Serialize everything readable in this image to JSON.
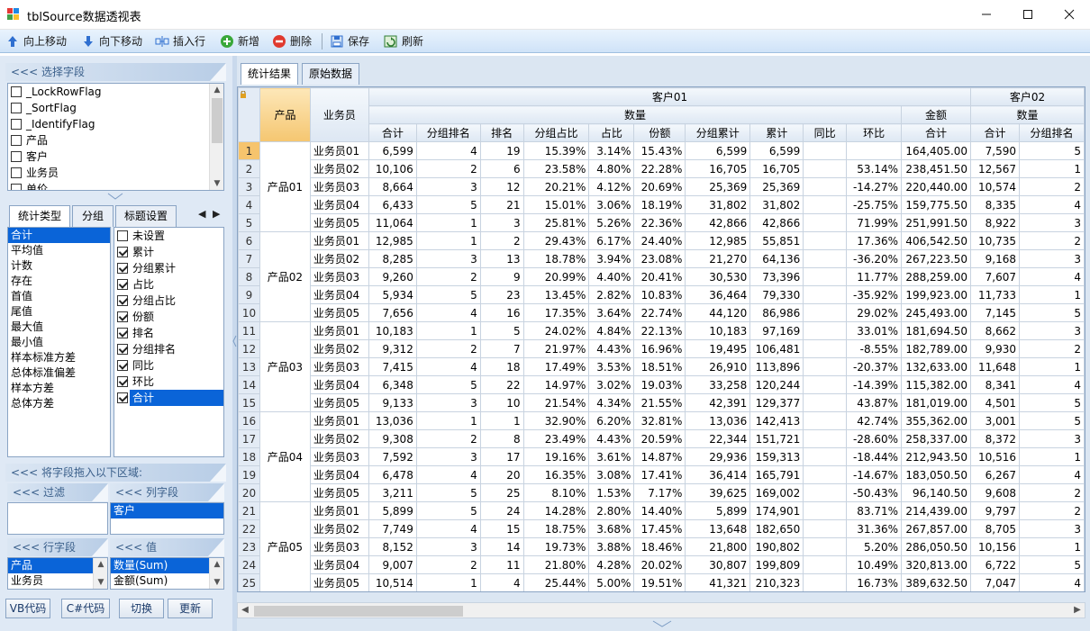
{
  "window": {
    "title": "tblSource数据透视表"
  },
  "toolbar": {
    "move_up": "向上移动",
    "move_down": "向下移动",
    "insert_row": "插入行",
    "add": "新增",
    "delete": "删除",
    "save": "保存",
    "refresh": "刷新"
  },
  "field_panel": {
    "header": "<<< 选择字段",
    "fields": [
      {
        "label": "_LockRowFlag",
        "checked": false
      },
      {
        "label": "_SortFlag",
        "checked": false
      },
      {
        "label": "_IdentifyFlag",
        "checked": false
      },
      {
        "label": "产品",
        "checked": false
      },
      {
        "label": "客户",
        "checked": false
      },
      {
        "label": "业务员",
        "checked": false
      },
      {
        "label": "单价",
        "checked": false
      }
    ]
  },
  "stat_tabs": [
    "统计类型",
    "分组",
    "标题设置"
  ],
  "stat_types": [
    "合计",
    "平均值",
    "计数",
    "存在",
    "首值",
    "尾值",
    "最大值",
    "最小值",
    "样本标准方差",
    "总体标准偏差",
    "样本方差",
    "总体方差"
  ],
  "stat_options": [
    {
      "label": "未设置",
      "checked": false
    },
    {
      "label": "累计",
      "checked": true
    },
    {
      "label": "分组累计",
      "checked": true
    },
    {
      "label": "占比",
      "checked": true
    },
    {
      "label": "分组占比",
      "checked": true
    },
    {
      "label": "份额",
      "checked": true
    },
    {
      "label": "排名",
      "checked": true
    },
    {
      "label": "分组排名",
      "checked": true
    },
    {
      "label": "同比",
      "checked": true
    },
    {
      "label": "环比",
      "checked": true
    },
    {
      "label": "合计",
      "checked": true
    }
  ],
  "drag_area": {
    "header": "<<< 将字段拖入以下区域:",
    "filter_header": "<<< 过滤",
    "column_header": "<<< 列字段",
    "column_fields": [
      "客户"
    ],
    "row_header": "<<< 行字段",
    "row_fields": [
      "产品",
      "业务员"
    ],
    "value_header": "<<< 值",
    "value_fields": [
      "数量(Sum)",
      "金额(Sum)"
    ]
  },
  "buttons": {
    "vb": "VB代码",
    "cs": "C#代码",
    "switch": "切换",
    "update": "更新"
  },
  "result_tabs": [
    "统计结果",
    "原始数据"
  ],
  "grid": {
    "row_field_product": "产品",
    "row_field_rep": "业务员",
    "customer1": "客户01",
    "customer2": "客户02",
    "qty_label": "数量",
    "amount_label": "金额",
    "qty_cols": [
      "合计",
      "分组排名",
      "排名",
      "分组占比",
      "占比",
      "份额",
      "分组累计",
      "累计",
      "同比",
      "环比"
    ],
    "amount_cols": [
      "合计"
    ],
    "c2_cols": [
      "合计",
      "分组排名"
    ],
    "products": [
      "产品01",
      "产品02",
      "产品03",
      "产品04",
      "产品05"
    ],
    "rows": [
      {
        "n": "1",
        "rep": "业务员01",
        "v": [
          "6,599",
          "4",
          "19",
          "15.39%",
          "3.14%",
          "15.43%",
          "6,599",
          "6,599",
          "",
          ""
        ],
        "amt": "164,405.00",
        "c2": [
          "7,590",
          "5"
        ]
      },
      {
        "n": "2",
        "rep": "业务员02",
        "v": [
          "10,106",
          "2",
          "6",
          "23.58%",
          "4.80%",
          "22.28%",
          "16,705",
          "16,705",
          "",
          "53.14%"
        ],
        "amt": "238,451.50",
        "c2": [
          "12,567",
          "1"
        ]
      },
      {
        "n": "3",
        "rep": "业务员03",
        "v": [
          "8,664",
          "3",
          "12",
          "20.21%",
          "4.12%",
          "20.69%",
          "25,369",
          "25,369",
          "",
          "-14.27%"
        ],
        "amt": "220,440.00",
        "c2": [
          "10,574",
          "2"
        ]
      },
      {
        "n": "4",
        "rep": "业务员04",
        "v": [
          "6,433",
          "5",
          "21",
          "15.01%",
          "3.06%",
          "18.19%",
          "31,802",
          "31,802",
          "",
          "-25.75%"
        ],
        "amt": "159,775.50",
        "c2": [
          "8,335",
          "4"
        ]
      },
      {
        "n": "5",
        "rep": "业务员05",
        "v": [
          "11,064",
          "1",
          "3",
          "25.81%",
          "5.26%",
          "22.36%",
          "42,866",
          "42,866",
          "",
          "71.99%"
        ],
        "amt": "251,991.50",
        "c2": [
          "8,922",
          "3"
        ]
      },
      {
        "n": "6",
        "rep": "业务员01",
        "v": [
          "12,985",
          "1",
          "2",
          "29.43%",
          "6.17%",
          "24.40%",
          "12,985",
          "55,851",
          "",
          "17.36%"
        ],
        "amt": "406,542.50",
        "c2": [
          "10,735",
          "2"
        ]
      },
      {
        "n": "7",
        "rep": "业务员02",
        "v": [
          "8,285",
          "3",
          "13",
          "18.78%",
          "3.94%",
          "23.08%",
          "21,270",
          "64,136",
          "",
          "-36.20%"
        ],
        "amt": "267,223.50",
        "c2": [
          "9,168",
          "3"
        ]
      },
      {
        "n": "8",
        "rep": "业务员03",
        "v": [
          "9,260",
          "2",
          "9",
          "20.99%",
          "4.40%",
          "20.41%",
          "30,530",
          "73,396",
          "",
          "11.77%"
        ],
        "amt": "288,259.00",
        "c2": [
          "7,607",
          "4"
        ]
      },
      {
        "n": "9",
        "rep": "业务员04",
        "v": [
          "5,934",
          "5",
          "23",
          "13.45%",
          "2.82%",
          "10.83%",
          "36,464",
          "79,330",
          "",
          "-35.92%"
        ],
        "amt": "199,923.00",
        "c2": [
          "11,733",
          "1"
        ]
      },
      {
        "n": "10",
        "rep": "业务员05",
        "v": [
          "7,656",
          "4",
          "16",
          "17.35%",
          "3.64%",
          "22.74%",
          "44,120",
          "86,986",
          "",
          "29.02%"
        ],
        "amt": "245,493.00",
        "c2": [
          "7,145",
          "5"
        ]
      },
      {
        "n": "11",
        "rep": "业务员01",
        "v": [
          "10,183",
          "1",
          "5",
          "24.02%",
          "4.84%",
          "22.13%",
          "10,183",
          "97,169",
          "",
          "33.01%"
        ],
        "amt": "181,694.50",
        "c2": [
          "8,662",
          "3"
        ]
      },
      {
        "n": "12",
        "rep": "业务员02",
        "v": [
          "9,312",
          "2",
          "7",
          "21.97%",
          "4.43%",
          "16.96%",
          "19,495",
          "106,481",
          "",
          "-8.55%"
        ],
        "amt": "182,789.00",
        "c2": [
          "9,930",
          "2"
        ]
      },
      {
        "n": "13",
        "rep": "业务员03",
        "v": [
          "7,415",
          "4",
          "18",
          "17.49%",
          "3.53%",
          "18.51%",
          "26,910",
          "113,896",
          "",
          "-20.37%"
        ],
        "amt": "132,633.00",
        "c2": [
          "11,648",
          "1"
        ]
      },
      {
        "n": "14",
        "rep": "业务员04",
        "v": [
          "6,348",
          "5",
          "22",
          "14.97%",
          "3.02%",
          "19.03%",
          "33,258",
          "120,244",
          "",
          "-14.39%"
        ],
        "amt": "115,382.00",
        "c2": [
          "8,341",
          "4"
        ]
      },
      {
        "n": "15",
        "rep": "业务员05",
        "v": [
          "9,133",
          "3",
          "10",
          "21.54%",
          "4.34%",
          "21.55%",
          "42,391",
          "129,377",
          "",
          "43.87%"
        ],
        "amt": "181,019.00",
        "c2": [
          "4,501",
          "5"
        ]
      },
      {
        "n": "16",
        "rep": "业务员01",
        "v": [
          "13,036",
          "1",
          "1",
          "32.90%",
          "6.20%",
          "32.81%",
          "13,036",
          "142,413",
          "",
          "42.74%"
        ],
        "amt": "355,362.00",
        "c2": [
          "3,001",
          "5"
        ]
      },
      {
        "n": "17",
        "rep": "业务员02",
        "v": [
          "9,308",
          "2",
          "8",
          "23.49%",
          "4.43%",
          "20.59%",
          "22,344",
          "151,721",
          "",
          "-28.60%"
        ],
        "amt": "258,337.00",
        "c2": [
          "8,372",
          "3"
        ]
      },
      {
        "n": "18",
        "rep": "业务员03",
        "v": [
          "7,592",
          "3",
          "17",
          "19.16%",
          "3.61%",
          "14.87%",
          "29,936",
          "159,313",
          "",
          "-18.44%"
        ],
        "amt": "212,943.50",
        "c2": [
          "10,516",
          "1"
        ]
      },
      {
        "n": "19",
        "rep": "业务员04",
        "v": [
          "6,478",
          "4",
          "20",
          "16.35%",
          "3.08%",
          "17.41%",
          "36,414",
          "165,791",
          "",
          "-14.67%"
        ],
        "amt": "183,050.50",
        "c2": [
          "6,267",
          "4"
        ]
      },
      {
        "n": "20",
        "rep": "业务员05",
        "v": [
          "3,211",
          "5",
          "25",
          "8.10%",
          "1.53%",
          "7.17%",
          "39,625",
          "169,002",
          "",
          "-50.43%"
        ],
        "amt": "96,140.50",
        "c2": [
          "9,608",
          "2"
        ]
      },
      {
        "n": "21",
        "rep": "业务员01",
        "v": [
          "5,899",
          "5",
          "24",
          "14.28%",
          "2.80%",
          "14.40%",
          "5,899",
          "174,901",
          "",
          "83.71%"
        ],
        "amt": "214,439.00",
        "c2": [
          "9,797",
          "2"
        ]
      },
      {
        "n": "22",
        "rep": "业务员02",
        "v": [
          "7,749",
          "4",
          "15",
          "18.75%",
          "3.68%",
          "17.45%",
          "13,648",
          "182,650",
          "",
          "31.36%"
        ],
        "amt": "267,857.00",
        "c2": [
          "8,705",
          "3"
        ]
      },
      {
        "n": "23",
        "rep": "业务员03",
        "v": [
          "8,152",
          "3",
          "14",
          "19.73%",
          "3.88%",
          "18.46%",
          "21,800",
          "190,802",
          "",
          "5.20%"
        ],
        "amt": "286,050.50",
        "c2": [
          "10,156",
          "1"
        ]
      },
      {
        "n": "24",
        "rep": "业务员04",
        "v": [
          "9,007",
          "2",
          "11",
          "21.80%",
          "4.28%",
          "20.02%",
          "30,807",
          "199,809",
          "",
          "10.49%"
        ],
        "amt": "320,813.00",
        "c2": [
          "6,722",
          "5"
        ]
      },
      {
        "n": "25",
        "rep": "业务员05",
        "v": [
          "10,514",
          "1",
          "4",
          "25.44%",
          "5.00%",
          "19.51%",
          "41,321",
          "210,323",
          "",
          "16.73%"
        ],
        "amt": "389,632.50",
        "c2": [
          "7,047",
          "4"
        ]
      }
    ]
  },
  "colors": {
    "selection": "#0a64d8",
    "row_field_header": "#f5c670",
    "toolbar_top": "#e9f3fd",
    "toolbar_bottom": "#cfe3f8"
  }
}
